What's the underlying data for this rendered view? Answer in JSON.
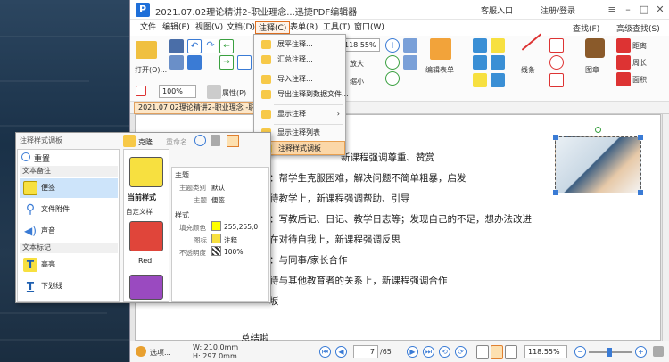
{
  "window": {
    "title": "2021.07.02理论精讲2-职业理念...迅捷PDF编辑器",
    "logo": "P",
    "register": "客服入口",
    "login": "注册/登录"
  },
  "menu": {
    "items": [
      "文件",
      "编辑(E)",
      "视图(V)",
      "文档(D)",
      "注释(C)",
      "表单(R)",
      "工具(T)",
      "窗口(W)"
    ],
    "active_index": 4,
    "find": "查找(F)",
    "adv_find": "高级查找(S)"
  },
  "toolbar": {
    "open_label": "打开(O)...",
    "zoom_value": "118.55%",
    "zoom_in": "放大",
    "zoom_out": "缩小",
    "edit_form": "编辑表单",
    "line": "线条",
    "shape": "图章",
    "distance": "距离",
    "perimeter": "周长",
    "area": "面积",
    "zoom_small": "100%",
    "properties": "属性(P)..."
  },
  "tab": {
    "label": "2021.07.02理论精讲2-职业理念 -职业..."
  },
  "dropdown": {
    "items": [
      "展平注释...",
      "汇总注释...",
      "导入注释...",
      "导出注释到数据文件...",
      "显示注释",
      "显示注释列表",
      "注释样式调板"
    ],
    "highlighted_index": 6
  },
  "document": {
    "lines": [
      "新课程强调尊重、赞赏",
      "：帮学生克服困难，解决问题不简单粗暴，启发",
      "待教学上，新课程强调帮助、引导",
      "：写教后记、日记、教学日志等；发现自己的不足，想办法改进",
      "在对待自我上，新课程强调反思",
      "：与同事/家长合作",
      "待与其他教育者的关系上，新课程强调合作",
      "坂",
      "总结啦"
    ]
  },
  "statusbar": {
    "options": "选项...",
    "width": "W: 210.0mm",
    "height": "H: 297.0mm",
    "page": "7",
    "page_total": "/65",
    "zoom": "118.55%"
  },
  "panel": {
    "title": "注释样式调板",
    "reset": "重置",
    "clone": "克隆",
    "rename": "重命名",
    "current_style": "当前样式",
    "custom_style": "自定义样",
    "red_label": "Red",
    "categories": [
      "文本备注",
      "文本标记"
    ],
    "items": [
      "便签",
      "文件附件",
      "声音",
      "高亮",
      "下划线"
    ],
    "selected_index": 0,
    "props": {
      "section1": "主题",
      "subject_type_label": "主题类别",
      "subject_type_value": "默认",
      "subject_label": "主题",
      "subject_value": "便签",
      "section2": "样式",
      "fill_label": "填充颜色",
      "fill_value": "255,255,0",
      "icon_label": "图标",
      "icon_value": "注释",
      "opacity_label": "不透明度",
      "opacity_value": "100%"
    }
  }
}
